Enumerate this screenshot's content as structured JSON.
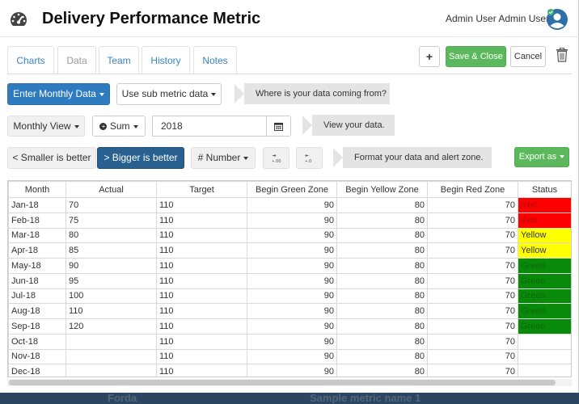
{
  "header": {
    "title": "Delivery Performance Metric",
    "user_name": "Admin User Admin User"
  },
  "tabs": [
    {
      "label": "Charts",
      "active": false
    },
    {
      "label": "Data",
      "active": true
    },
    {
      "label": "Team",
      "active": false
    },
    {
      "label": "History",
      "active": false
    },
    {
      "label": "Notes",
      "active": false
    }
  ],
  "actions": {
    "add_label": "+",
    "save_close_label": "Save & Close",
    "cancel_label": "Cancel"
  },
  "row1": {
    "enter_monthly_label": "Enter Monthly Data",
    "sub_metric_label": "Use sub metric data",
    "hint": "Where is your data coming from?"
  },
  "row2": {
    "view_label": "Monthly View",
    "sum_label": "Sum",
    "year_value": "2018",
    "hint": "View your data."
  },
  "row3": {
    "smaller_label": "< Smaller is better",
    "bigger_label": "> Bigger is better",
    "format_label": "# Number",
    "hint": "Format your data and alert zone.",
    "export_label": "Export as"
  },
  "table": {
    "columns": [
      "Month",
      "Actual",
      "Target",
      "Begin Green Zone",
      "Begin Yellow Zone",
      "Begin Red Zone",
      "Status"
    ],
    "rows": [
      {
        "month": "Jan-18",
        "actual": "70",
        "target": "110",
        "green": "90",
        "yellow": "80",
        "red": "70",
        "status": "Red"
      },
      {
        "month": "Feb-18",
        "actual": "75",
        "target": "110",
        "green": "90",
        "yellow": "80",
        "red": "70",
        "status": "Red"
      },
      {
        "month": "Mar-18",
        "actual": "80",
        "target": "110",
        "green": "90",
        "yellow": "80",
        "red": "70",
        "status": "Yellow"
      },
      {
        "month": "Apr-18",
        "actual": "85",
        "target": "110",
        "green": "90",
        "yellow": "80",
        "red": "70",
        "status": "Yellow"
      },
      {
        "month": "May-18",
        "actual": "90",
        "target": "110",
        "green": "90",
        "yellow": "80",
        "red": "70",
        "status": "Green"
      },
      {
        "month": "Jun-18",
        "actual": "95",
        "target": "110",
        "green": "90",
        "yellow": "80",
        "red": "70",
        "status": "Green"
      },
      {
        "month": "Jul-18",
        "actual": "100",
        "target": "110",
        "green": "90",
        "yellow": "80",
        "red": "70",
        "status": "Green"
      },
      {
        "month": "Aug-18",
        "actual": "110",
        "target": "110",
        "green": "90",
        "yellow": "80",
        "red": "70",
        "status": "Green"
      },
      {
        "month": "Sep-18",
        "actual": "120",
        "target": "110",
        "green": "90",
        "yellow": "80",
        "red": "70",
        "status": "Green"
      },
      {
        "month": "Oct-18",
        "actual": "",
        "target": "110",
        "green": "90",
        "yellow": "80",
        "red": "70",
        "status": ""
      },
      {
        "month": "Nov-18",
        "actual": "",
        "target": "110",
        "green": "90",
        "yellow": "80",
        "red": "70",
        "status": ""
      },
      {
        "month": "Dec-18",
        "actual": "",
        "target": "110",
        "green": "90",
        "yellow": "80",
        "red": "70",
        "status": ""
      }
    ]
  },
  "background": {
    "left_text": "Forda",
    "right_text": "Sample metric name 1"
  },
  "colors": {
    "primary": "#2f7bc0",
    "success": "#5cb85c",
    "status_red": "#ff0000",
    "status_yellow": "#ffff00",
    "status_green": "#0a8a0a"
  }
}
